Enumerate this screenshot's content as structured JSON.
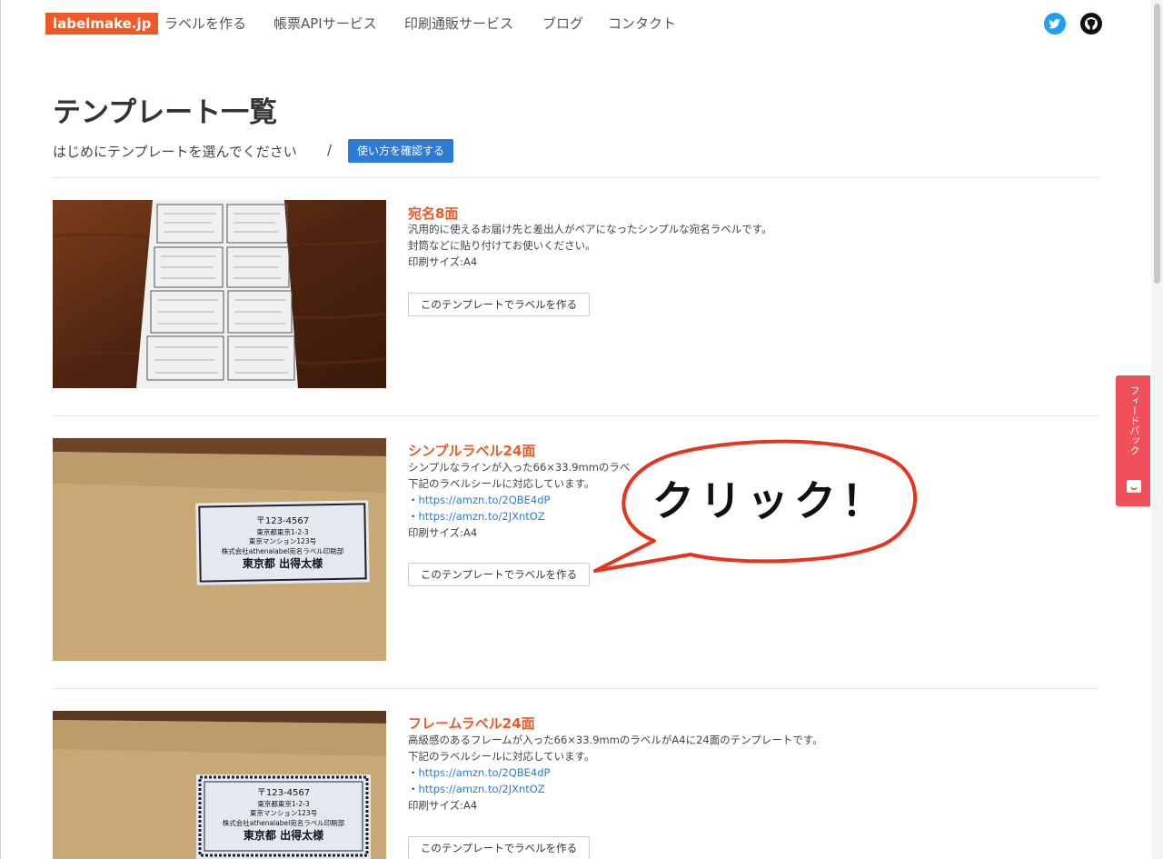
{
  "navbar": {
    "brand": "labelmake.jp",
    "items": [
      {
        "label": "ラベルを作る"
      },
      {
        "label": "帳票APIサービス"
      },
      {
        "label": "印刷通販サービス"
      },
      {
        "label": "ブログ"
      },
      {
        "label": "コンタクト"
      }
    ],
    "icons": [
      "twitter-icon",
      "github-icon"
    ]
  },
  "header": {
    "title": "テンプレート一覧",
    "subtitle": "はじめにテンプレートを選んでください",
    "separator": "/",
    "howto_button": "使い方を確認する"
  },
  "templates": [
    {
      "title": "宛名8面",
      "lines": [
        "汎用的に使えるお届け先と差出人がペアになったシンプルな宛名ラベルです。",
        "封筒などに貼り付けてお使いください。",
        "印刷サイズ:A4"
      ],
      "button": "このテンプレートでラベルを作る"
    },
    {
      "title": "シンプルラベル24面",
      "lines": [
        "シンプルなラインが入った66×33.9mmのラベ",
        "下記のラベルシールに対応しています。"
      ],
      "links": [
        "https://amzn.to/2QBE4dP",
        "https://amzn.to/2JXntOZ"
      ],
      "size": "印刷サイズ:A4",
      "button": "このテンプレートでラベルを作る",
      "label_text": [
        "〒123-4567",
        "東京都東京1-2-3",
        "東京マンション123号",
        "株式会社athenalabel宛名ラベル印刷部",
        "東京都 出得太様"
      ]
    },
    {
      "title": "フレームラベル24面",
      "lines": [
        "高級感のあるフレームが入った66×33.9mmのラベルがA4に24面のテンプレートです。",
        "下記のラベルシールに対応しています。"
      ],
      "links": [
        "https://amzn.to/2QBE4dP",
        "https://amzn.to/2JXntOZ"
      ],
      "size": "印刷サイズ:A4",
      "button": "このテンプレートでラベルを作る",
      "label_text": [
        "〒123-4567",
        "東京都東京1-2-3",
        "東京マンション123号",
        "株式会社athenalabel宛名ラベル印刷部",
        "東京都 出得太様"
      ]
    }
  ],
  "callout": {
    "text": "クリック！"
  },
  "feedback": {
    "label": "フィードバック"
  },
  "link_bullet": "・",
  "colors": {
    "brand": "#f05a28",
    "accent": "#2e7bd6",
    "feedback": "#f0505a"
  }
}
